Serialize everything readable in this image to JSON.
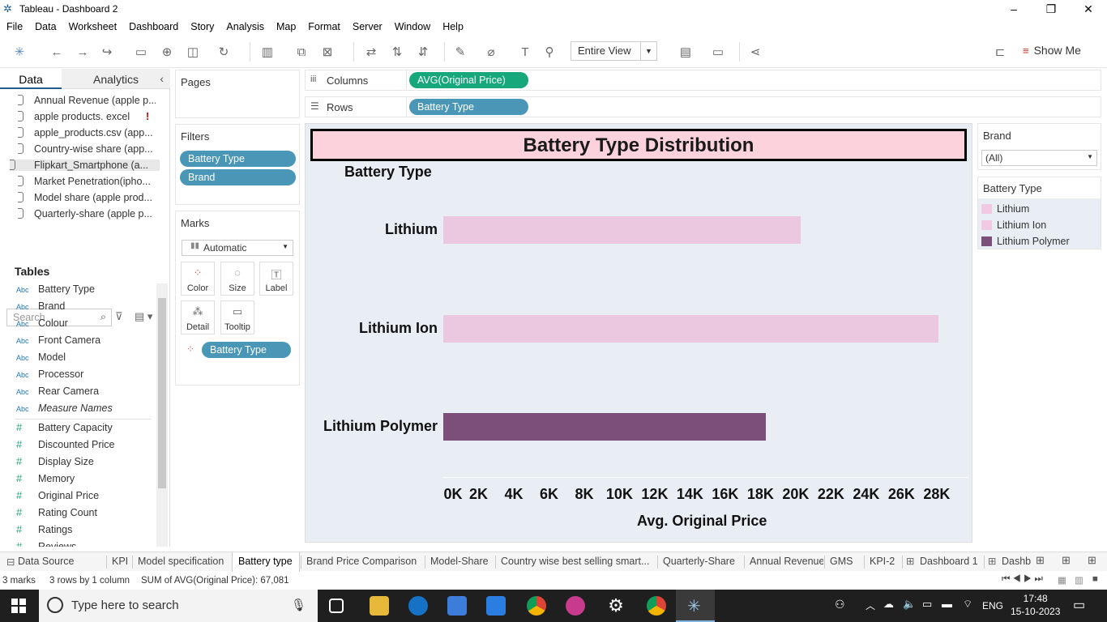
{
  "window": {
    "title": "Tableau - Dashboard 2"
  },
  "menu": [
    "File",
    "Data",
    "Worksheet",
    "Dashboard",
    "Story",
    "Analysis",
    "Map",
    "Format",
    "Server",
    "Window",
    "Help"
  ],
  "toolbar": {
    "fit": "Entire View",
    "show_me": "Show Me"
  },
  "data_pane": {
    "tabs": [
      "Data",
      "Analytics"
    ],
    "datasources": [
      "Annual Revenue (apple p...",
      "apple products. excel",
      "apple_products.csv (app...",
      "Country-wise share (app...",
      "Flipkart_Smartphone (a...",
      "Market Penetration(ipho...",
      "Model share (apple prod...",
      "Quarterly-share (apple p..."
    ],
    "search_placeholder": "Search",
    "tables_label": "Tables",
    "dimensions": [
      "Battery Type",
      "Brand",
      "Colour",
      "Front Camera",
      "Model",
      "Processor",
      "Rear Camera",
      "Measure Names"
    ],
    "measures": [
      "Battery Capacity",
      "Discounted Price",
      "Display Size",
      "Memory",
      "Original Price",
      "Rating Count",
      "Ratings",
      "Reviews"
    ],
    "dim_type": "Abc",
    "measure_type": "#"
  },
  "shelves": {
    "pages": "Pages",
    "filters_title": "Filters",
    "filters": [
      "Battery Type",
      "Brand"
    ],
    "marks_title": "Marks",
    "mark_type": "Automatic",
    "mark_buttons": [
      "Color",
      "Size",
      "Label",
      "Detail",
      "Tooltip"
    ],
    "mark_pill": "Battery Type",
    "columns_label": "Columns",
    "columns_pill": "AVG(Original Price)",
    "rows_label": "Rows",
    "rows_pill": "Battery Type"
  },
  "chart_data": {
    "type": "bar",
    "title": "Battery Type Distribution",
    "row_header": "Battery Type",
    "categories": [
      "Lithium",
      "Lithium Ion",
      "Lithium Polymer"
    ],
    "values": [
      20300,
      28100,
      18300
    ],
    "colors": [
      "#ecc8e0",
      "#ecc8e0",
      "#7b4f7a"
    ],
    "xlabel": "Avg. Original Price",
    "xlim": [
      0,
      29800
    ],
    "ticks": [
      0,
      2000,
      4000,
      6000,
      8000,
      10000,
      12000,
      14000,
      16000,
      18000,
      20000,
      22000,
      24000,
      26000,
      28000
    ],
    "tick_labels": [
      "0K",
      "2K",
      "4K",
      "6K",
      "8K",
      "10K",
      "12K",
      "14K",
      "16K",
      "18K",
      "20K",
      "22K",
      "24K",
      "26K",
      "28K"
    ]
  },
  "brand_filter": {
    "title": "Brand",
    "value": "(All)"
  },
  "legend": {
    "title": "Battery Type",
    "items": [
      {
        "label": "Lithium",
        "color": "#f2c9e2"
      },
      {
        "label": "Lithium Ion",
        "color": "#f2c9e2"
      },
      {
        "label": "Lithium Polymer",
        "color": "#7b4f7a"
      }
    ]
  },
  "sheet_tabs": [
    "Data Source",
    "KPI",
    "Model specification",
    "Battery type",
    "Brand Price Comparison",
    "Model-Share",
    "Country wise best selling smart...",
    "Quarterly-Share",
    "Annual Revenue",
    "GMS",
    "KPI-2",
    "Dashboard 1",
    "Dashb"
  ],
  "active_tab": "Battery type",
  "status": {
    "marks": "3 marks",
    "dims": "3 rows by 1 column",
    "sum": "SUM of AVG(Original Price): 67,081"
  },
  "taskbar": {
    "search": "Type here to search",
    "lang": "ENG",
    "time": "17:48",
    "date": "15-10-2023"
  }
}
